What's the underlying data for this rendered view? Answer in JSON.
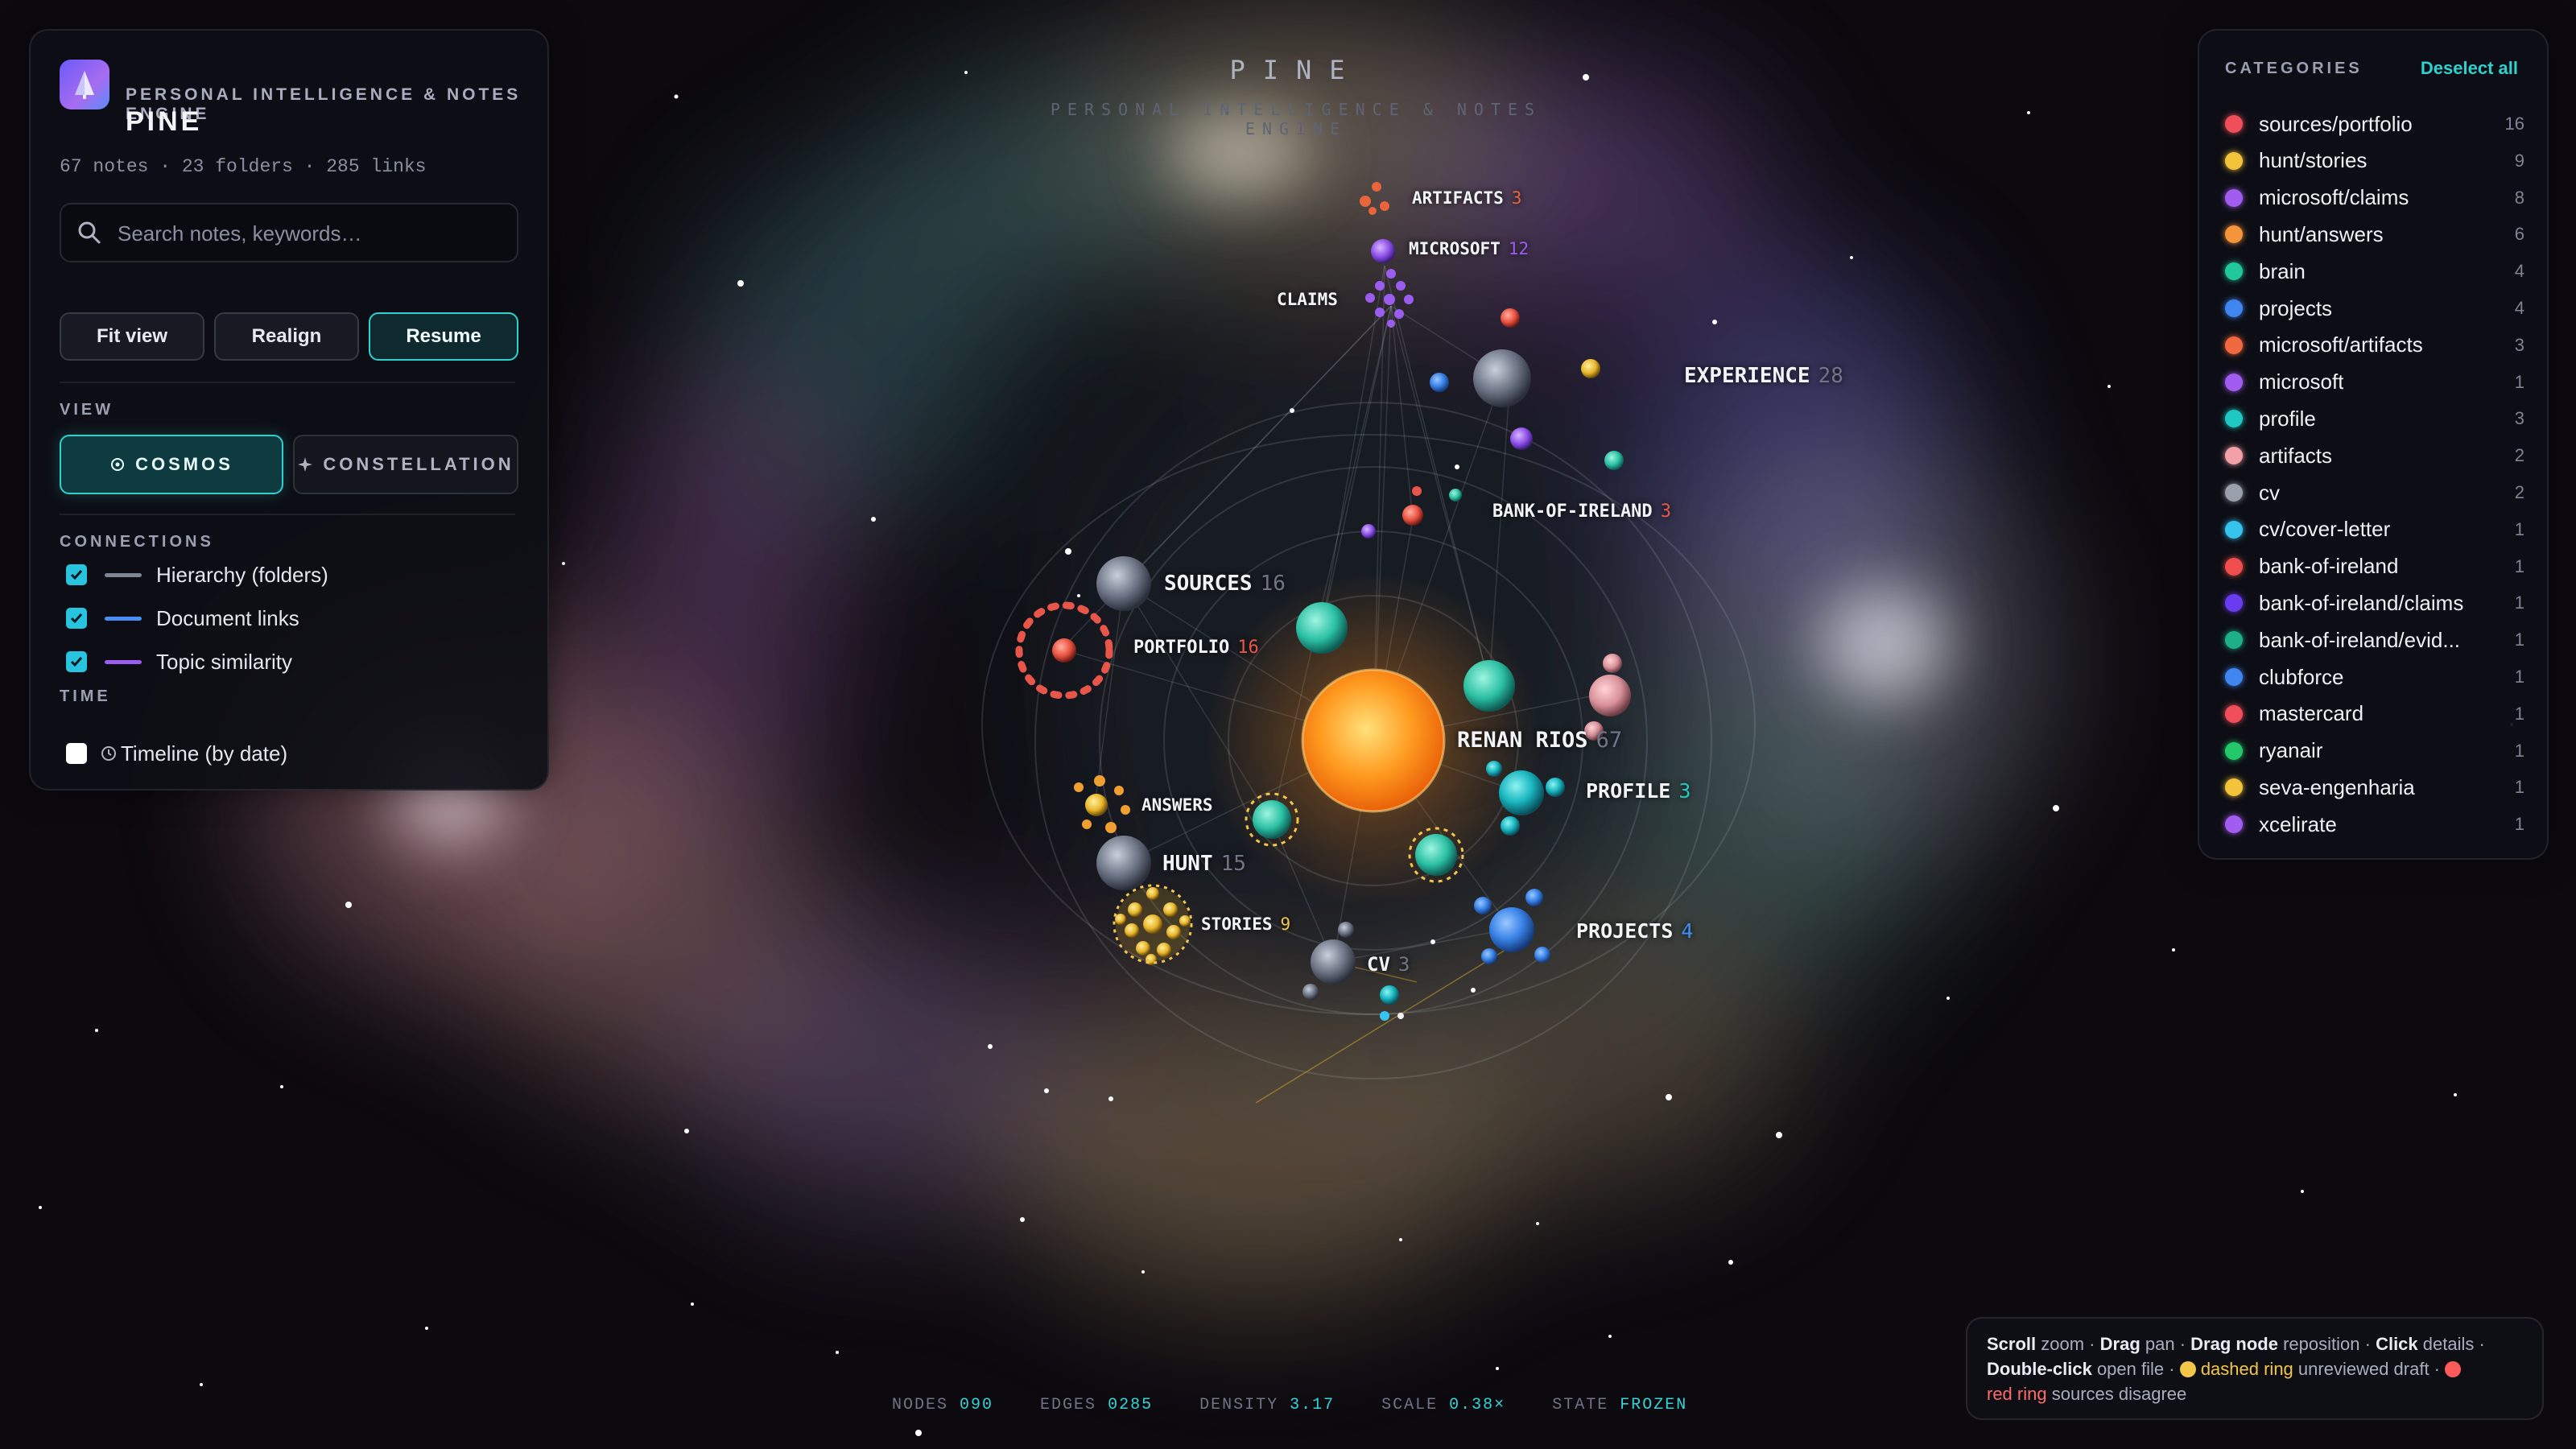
{
  "app": {
    "name": "PINE",
    "subtitle": "PERSONAL INTELLIGENCE & NOTES ENGINE",
    "stats": "67 notes · 23 folders · 285 links"
  },
  "search": {
    "placeholder": "Search notes, keywords…"
  },
  "toolbar": {
    "fit_view": "Fit view",
    "realign": "Realign",
    "resume": "Resume"
  },
  "view": {
    "section_label": "VIEW",
    "cosmos": "COSMOS",
    "constellation": "CONSTELLATION",
    "selected": "cosmos"
  },
  "connections": {
    "section_label": "CONNECTIONS",
    "items": [
      {
        "label": "Hierarchy (folders)",
        "checked": true,
        "color": "#7d8594"
      },
      {
        "label": "Document links",
        "checked": true,
        "color": "#4b8cf5"
      },
      {
        "label": "Topic similarity",
        "checked": true,
        "color": "#9b5cf0"
      }
    ]
  },
  "time": {
    "section_label": "TIME",
    "timeline_label": "Timeline (by date)",
    "checked": false
  },
  "canvas": {
    "title": "PINE",
    "subtitle": "PERSONAL INTELLIGENCE & NOTES ENGINE",
    "labels": [
      {
        "text": "ARTIFACTS",
        "count": "3",
        "color": "#e8643a"
      },
      {
        "text": "MICROSOFT",
        "count": "12",
        "color": "#9b5cf0"
      },
      {
        "text": "CLAIMS",
        "count": "",
        "color": "#9b5cf0"
      },
      {
        "text": "EXPERIENCE",
        "count": "28",
        "color": "#8b93a6"
      },
      {
        "text": "BANK-OF-IRELAND",
        "count": "3",
        "color": "#e8564a"
      },
      {
        "text": "SOURCES",
        "count": "16",
        "color": "#8b93a6"
      },
      {
        "text": "PORTFOLIO",
        "count": "16",
        "color": "#e8564a"
      },
      {
        "text": "RENAN RIOS",
        "count": "67",
        "color": "#8b93a6"
      },
      {
        "text": "PROFILE",
        "count": "3",
        "color": "#25c5c0"
      },
      {
        "text": "ANSWERS",
        "count": "",
        "color": "#f0a030"
      },
      {
        "text": "HUNT",
        "count": "15",
        "color": "#8b93a6"
      },
      {
        "text": "STORIES",
        "count": "9",
        "color": "#f3c64a"
      },
      {
        "text": "CV",
        "count": "3",
        "color": "#8b93a6"
      },
      {
        "text": "PROJECTS",
        "count": "4",
        "color": "#3d8ef0"
      }
    ]
  },
  "categories": {
    "header": "CATEGORIES",
    "deselect_label": "Deselect all",
    "items": [
      {
        "name": "sources/portfolio",
        "count": "16",
        "color": "#f04e5a"
      },
      {
        "name": "hunt/stories",
        "count": "9",
        "color": "#f3c33b"
      },
      {
        "name": "microsoft/claims",
        "count": "8",
        "color": "#a35cf0"
      },
      {
        "name": "hunt/answers",
        "count": "6",
        "color": "#f5953b"
      },
      {
        "name": "brain",
        "count": "4",
        "color": "#22c89a"
      },
      {
        "name": "projects",
        "count": "4",
        "color": "#3f86f0"
      },
      {
        "name": "microsoft/artifacts",
        "count": "3",
        "color": "#f0693f"
      },
      {
        "name": "microsoft",
        "count": "1",
        "color": "#a35cf0"
      },
      {
        "name": "profile",
        "count": "3",
        "color": "#1fc7c2"
      },
      {
        "name": "artifacts",
        "count": "2",
        "color": "#f4a0a8"
      },
      {
        "name": "cv",
        "count": "2",
        "color": "#9aa0ab"
      },
      {
        "name": "cv/cover-letter",
        "count": "1",
        "color": "#37c3ee"
      },
      {
        "name": "bank-of-ireland",
        "count": "1",
        "color": "#f04e4e"
      },
      {
        "name": "bank-of-ireland/claims",
        "count": "1",
        "color": "#6a3cf0"
      },
      {
        "name": "bank-of-ireland/evid...",
        "count": "1",
        "color": "#1faf88"
      },
      {
        "name": "clubforce",
        "count": "1",
        "color": "#3f86f0"
      },
      {
        "name": "mastercard",
        "count": "1",
        "color": "#f04e5a"
      },
      {
        "name": "ryanair",
        "count": "1",
        "color": "#22c86a"
      },
      {
        "name": "seva-engenharia",
        "count": "1",
        "color": "#f3c33b"
      },
      {
        "name": "xcelirate",
        "count": "1",
        "color": "#a35cf0"
      }
    ]
  },
  "hints": {
    "scroll": "Scroll",
    "scroll_action": "zoom ·",
    "drag": "Drag",
    "drag_action": "pan ·",
    "drag_node": "Drag node",
    "drag_node_action": "reposition ·",
    "click": "Click",
    "click_action": "details ·",
    "double_click": "Double-click",
    "double_click_action": "open file ·",
    "dashed_ring": "dashed ring",
    "dashed_ring_action": "unreviewed draft ·",
    "red_ring": "red ring",
    "red_ring_action": "sources disagree"
  },
  "status": {
    "nodes_label": "NODES",
    "nodes_value": "090",
    "edges_label": "EDGES",
    "edges_value": "0285",
    "density_label": "DENSITY",
    "density_value": "3.17",
    "scale_label": "SCALE",
    "scale_value": "0.38×",
    "state_label": "STATE",
    "state_value": "FROZEN"
  }
}
